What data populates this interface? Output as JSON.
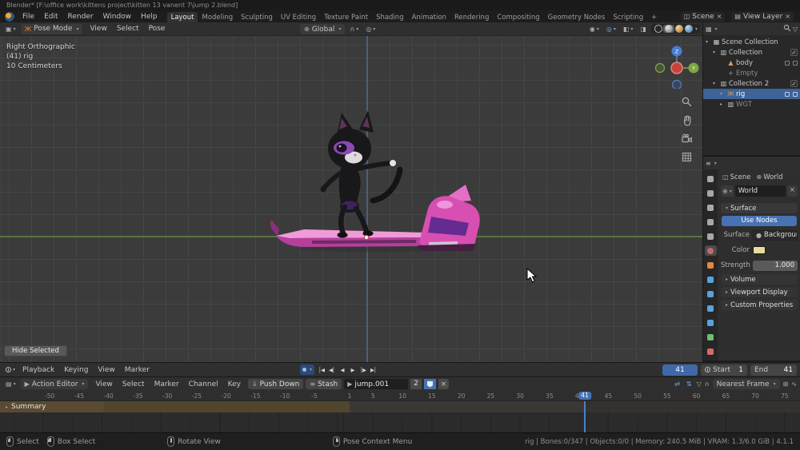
{
  "window": {
    "title": "Blender* [F:\\office work\\kittens project\\kitten 13 vanent 7\\jump 2.blend]"
  },
  "topbar": {
    "menus": [
      "File",
      "Edit",
      "Render",
      "Window",
      "Help"
    ],
    "workspaces": [
      "Layout",
      "Modeling",
      "Sculpting",
      "UV Editing",
      "Texture Paint",
      "Shading",
      "Animation",
      "Rendering",
      "Compositing",
      "Geometry Nodes",
      "Scripting",
      "+"
    ],
    "active_workspace": "Layout",
    "scene_selector": {
      "label": "Scene"
    },
    "view_layer_selector": {
      "label": "View Layer"
    }
  },
  "viewport": {
    "header": {
      "mode": "Pose Mode",
      "menus": [
        "View",
        "Select",
        "Pose"
      ],
      "orientation": "Global"
    },
    "overlay": {
      "view_label": "Right Orthographic",
      "context_label": "(41) rig",
      "scale_label": "10 Centimeters"
    },
    "gizmo": {
      "z_label": "Z",
      "y_label": "Y"
    },
    "hide_selected_button": "Hide Selected"
  },
  "outliner": {
    "rows": [
      {
        "label": "Scene Collection",
        "icon": "scene-collection",
        "depth": 0,
        "chevron": "▾"
      },
      {
        "label": "Collection",
        "icon": "collection",
        "depth": 1,
        "chevron": "▾",
        "checkbox": true
      },
      {
        "label": "body",
        "icon": "mesh",
        "depth": 2,
        "right_icons": [
          "modifier-wrench-icon",
          "screen-icon"
        ]
      },
      {
        "label": "Empty",
        "icon": "empty",
        "depth": 2,
        "dim": true
      },
      {
        "label": "Collection 2",
        "icon": "collection",
        "depth": 1,
        "chevron": "▾",
        "checkbox": true
      },
      {
        "label": "rig",
        "icon": "armature",
        "depth": 2,
        "chevron": "▾",
        "selected": true,
        "right_icons": [
          "pose-icon",
          "visibility-icon"
        ]
      },
      {
        "label": "WGT",
        "icon": "collection",
        "depth": 2,
        "chevron": "▸",
        "dim": true
      }
    ]
  },
  "properties": {
    "breadcrumb": {
      "scene": "Scene",
      "world": "World"
    },
    "world_block": {
      "name": "World"
    },
    "surface_panel": {
      "title": "Surface",
      "use_nodes_button": "Use Nodes",
      "surface_label": "Surface",
      "surface_value": "Background",
      "color_label": "Color",
      "color_hex": "#e6dd9c",
      "strength_label": "Strength",
      "strength_value": "1.000"
    },
    "collapsed_panels": [
      "Volume",
      "Viewport Display",
      "Custom Properties"
    ],
    "tabs": [
      {
        "name": "tool",
        "color": "#a8a8a8"
      },
      {
        "name": "render",
        "color": "#a8a8a8"
      },
      {
        "name": "output",
        "color": "#a8a8a8"
      },
      {
        "name": "view-layer",
        "color": "#a8a8a8"
      },
      {
        "name": "scene",
        "color": "#a8a8a8"
      },
      {
        "name": "world",
        "color": "#c56a6a",
        "active": true
      },
      {
        "name": "object",
        "color": "#e0883c"
      },
      {
        "name": "modifiers",
        "color": "#57a3dd"
      },
      {
        "name": "particles",
        "color": "#57a3dd"
      },
      {
        "name": "physics",
        "color": "#57a3dd"
      },
      {
        "name": "constraints",
        "color": "#57a3dd"
      },
      {
        "name": "object-data",
        "color": "#6cc06c"
      },
      {
        "name": "material",
        "color": "#d66a6a"
      }
    ]
  },
  "timeline": {
    "menus": [
      "Playback",
      "Keying",
      "View",
      "Marker"
    ],
    "current_frame": "41",
    "start": {
      "label": "Start",
      "value": "1"
    },
    "end": {
      "label": "End",
      "value": "41"
    },
    "playback_icons": [
      {
        "name": "jump-to-start-icon",
        "glyph": "│◀"
      },
      {
        "name": "prev-keyframe-icon",
        "glyph": "◀│"
      },
      {
        "name": "play-reverse-icon",
        "glyph": "◀"
      },
      {
        "name": "play-icon",
        "glyph": "▶"
      },
      {
        "name": "next-keyframe-icon",
        "glyph": "│▶"
      },
      {
        "name": "jump-to-end-icon",
        "glyph": "▶│"
      }
    ]
  },
  "dopesheet": {
    "mode": "Action Editor",
    "menus": [
      "View",
      "Select",
      "Marker",
      "Channel",
      "Key"
    ],
    "push_down_button": "Push Down",
    "stash_button": "Stash",
    "action": {
      "name": "jump.001",
      "users": "2"
    },
    "snap_mode": "Nearest Frame",
    "summary_label": "Summary",
    "ruler_frames": [
      -50,
      -45,
      -40,
      -35,
      -30,
      -25,
      -20,
      -15,
      -10,
      -5,
      1,
      5,
      10,
      15,
      20,
      25,
      30,
      35,
      40,
      45,
      50,
      55,
      60,
      65,
      70,
      75
    ],
    "playhead_frame": "41"
  },
  "statusbar": {
    "hints": [
      {
        "button": "left",
        "label": "Select"
      },
      {
        "button": "left-drag",
        "label": "Box Select"
      },
      {
        "button": "middle",
        "label": "Rotate View"
      },
      {
        "button": "right",
        "label": "Pose Context Menu"
      }
    ],
    "info": "rig | Bones:0/347 | Objects:0/0 | Memory: 240.5 MiB | VRAM: 1.3/6.0 GiB | 4.1.1"
  }
}
